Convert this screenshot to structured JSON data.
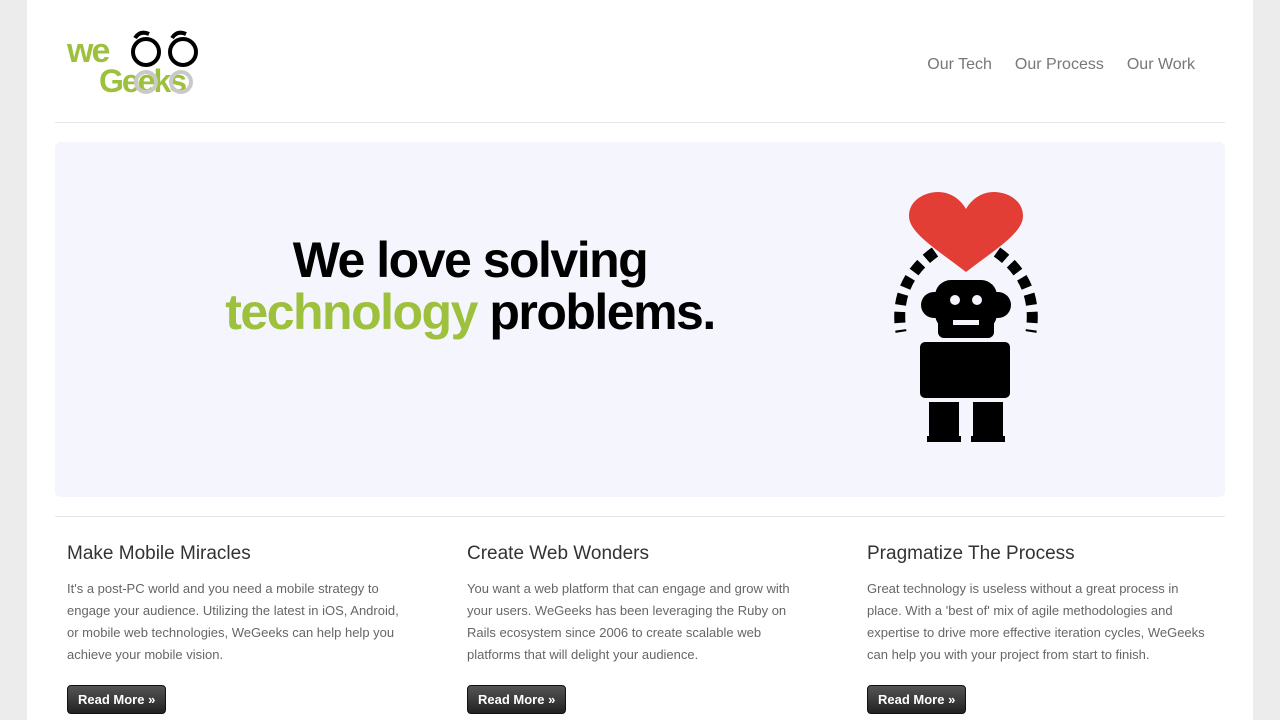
{
  "logo": {
    "text_top": "we",
    "text_bottom": "Geeks",
    "brand_color": "#9dc13c"
  },
  "nav": {
    "items": [
      "Our Tech",
      "Our Process",
      "Our Work"
    ]
  },
  "hero": {
    "line1": "We love solving",
    "accent": "technology",
    "line2_rest": " problems.",
    "accent_color": "#9dc13c",
    "heart_color": "#e23e36"
  },
  "columns": [
    {
      "title": "Make Mobile Miracles",
      "body": "It's a post-PC world and you need a mobile strategy to engage your audience. Utilizing the latest in iOS, Android, or mobile web technologies, WeGeeks can help help you achieve your mobile vision.",
      "button": "Read More »"
    },
    {
      "title": "Create Web Wonders",
      "body": "You want a web platform that can engage and grow with your users. WeGeeks has been leveraging the Ruby on Rails ecosystem since 2006 to create scalable web platforms that will delight your audience.",
      "button": "Read More »"
    },
    {
      "title": "Pragmatize The Process",
      "body": "Great technology is useless without a great process in place. With a 'best of' mix of agile methodologies and expertise to drive more effective iteration cycles, WeGeeks can help you with your project from start to finish.",
      "button": "Read More »"
    }
  ]
}
